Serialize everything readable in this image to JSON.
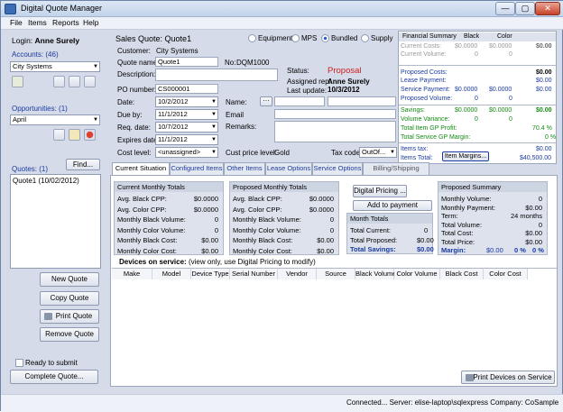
{
  "window": {
    "title": "Digital Quote Manager",
    "min": "—",
    "max": "▢",
    "close": "✕"
  },
  "menu": [
    "File",
    "Items",
    "Reports",
    "Help"
  ],
  "left": {
    "login_label": "Login:",
    "login_user": "Anne Surely",
    "accounts_label": "Accounts:",
    "accounts_count": "(46)",
    "account_selected": "City Systems",
    "opportunities_label": "Opportunities:",
    "opportunities_count": "(1)",
    "opportunity_selected": "April",
    "quotes_label": "Quotes:",
    "quotes_count": "(1)",
    "find_label": "Find...",
    "quotes": [
      "Quote1 (10/02/2012)"
    ],
    "new_quote": "New Quote",
    "copy_quote": "Copy Quote",
    "print_quote": "Print Quote",
    "remove_quote": "Remove Quote",
    "ready_label": "Ready to submit",
    "complete_quote": "Complete Quote..."
  },
  "header": {
    "title": "Sales Quote:",
    "title_value": "Quote1",
    "radios": [
      {
        "label": "Equipment",
        "on": false
      },
      {
        "label": "MPS",
        "on": false
      },
      {
        "label": "Bundled",
        "on": true
      },
      {
        "label": "Supply",
        "on": false
      }
    ]
  },
  "form": {
    "customer_label": "Customer:",
    "customer_value": "City Systems",
    "quote_name_label": "Quote name:",
    "quote_name_value": "Quote1",
    "no_label": "No:",
    "no_value": "DQM1000",
    "description_label": "Description:",
    "po_label": "PO number:",
    "po_value": "CS000001",
    "date_label": "Date:",
    "date_value": "10/2/2012",
    "due_label": "Due by:",
    "due_value": "11/1/2012",
    "req_label": "Req. date:",
    "req_value": "10/7/2012",
    "exp_label": "Expires date:",
    "exp_value": "11/1/2012",
    "cost_level_label": "Cost level:",
    "cost_level_value": "<unassigned>",
    "status_label": "Status:",
    "status_value": "Proposal",
    "rep_label": "Assigned rep:",
    "rep_value": "Anne Surely",
    "update_label": "Last update:",
    "update_value": "10/3/2012",
    "name_label": "Name:",
    "email_label": "Email",
    "remarks_label": "Remarks:",
    "cust_price_label": "Cust price level:",
    "cust_price_value": "Gold",
    "tax_label": "Tax code:",
    "tax_value": "OutOf..."
  },
  "financial": {
    "head": "Financial Summary",
    "black": "Black",
    "color": "Color",
    "current_costs": "Current Costs:",
    "cc_b": "$0.0000",
    "cc_c": "$0.0000",
    "cc_t": "$0.00",
    "current_volume": "Current Volume:",
    "cv_b": "0",
    "cv_c": "0",
    "proposed_costs": "Proposed Costs:",
    "pc_t": "$0.00",
    "lease_payment": "Lease Payment:",
    "lp_t": "$0.00",
    "service_payment": "Service Payment:",
    "sp_b": "$0.0000",
    "sp_c": "$0.0000",
    "sp_t": "$0.00",
    "proposed_volume": "Proposed Volume:",
    "pv_b": "0",
    "pv_c": "0",
    "savings": "Savings:",
    "sv_b": "$0.0000",
    "sv_c": "$0.0000",
    "sv_t": "$0.00",
    "volume_variance": "Volume Variance:",
    "vv_b": "0",
    "vv_c": "0",
    "total_item_gp": "Total Item GP Profit:",
    "tig": "70.4 %",
    "total_service_gp": "Total Service GP Margin:",
    "tsg": "0 %",
    "items_tax": "Items tax:",
    "it": "$0.00",
    "items_total": "Items Total:",
    "itt": "$40,500.00",
    "item_margins": "Item Margins..."
  },
  "tabs": [
    "Current Situation",
    "Configured Items",
    "Other Items",
    "Lease Options",
    "Service Options",
    "Billing/Shipping"
  ],
  "current": {
    "head": "Current Monthly Totals",
    "rows": [
      [
        "Avg. Black CPP:",
        "$0.0000"
      ],
      [
        "Avg. Color CPP:",
        "$0.0000"
      ],
      [
        "Monthly Black Volume:",
        "0"
      ],
      [
        "Monthly Color Volume:",
        "0"
      ],
      [
        "Monthly Black Cost:",
        "$0.00"
      ],
      [
        "Monthly Color Cost:",
        "$0.00"
      ]
    ]
  },
  "proposed": {
    "head": "Proposed Monthly Totals",
    "rows": [
      [
        "Avg. Black CPP:",
        "$0.0000"
      ],
      [
        "Avg. Color CPP:",
        "$0.0000"
      ],
      [
        "Monthly Black Volume:",
        "0"
      ],
      [
        "Monthly Color Volume:",
        "0"
      ],
      [
        "Monthly Black Cost:",
        "$0.00"
      ],
      [
        "Monthly Color Cost:",
        "$0.00"
      ]
    ]
  },
  "digital_pricing": "Digital Pricing ...",
  "add_payment": "Add to payment",
  "month_totals": {
    "head": "Month Totals",
    "current": "Total Current:",
    "cur_v": "0",
    "proposed": "Total Proposed:",
    "pro_v": "$0.00",
    "savings": "Total Savings:",
    "sav_v": "$0.00"
  },
  "psummary": {
    "head": "Proposed Summary",
    "rows": [
      [
        "Monthly Volume:",
        "0"
      ],
      [
        "Monthly Payment:",
        "$0.00"
      ],
      [
        "Term:",
        "24  months"
      ],
      [
        "Total Volume:",
        "0"
      ],
      [
        "Total Cost:",
        "$0.00"
      ],
      [
        "Total Price:",
        "$0.00"
      ]
    ],
    "margin_label": "Margin:",
    "margin_a": "$0.00",
    "margin_b": "0 %",
    "margin_c": "0 %"
  },
  "devices": {
    "title": "Devices on service:",
    "note": "(view only, use Digital Pricing to modify)",
    "columns": [
      "Make",
      "Model",
      "Device Type",
      "Serial Number",
      "Vendor",
      "Source",
      "Black Volume",
      "Color Volume",
      "Black Cost",
      "Color Cost"
    ],
    "print_devices": "Print Devices on Service"
  },
  "status": {
    "text": "Connected... Server: elise-laptop\\sqlexpress  Company: CoSample"
  }
}
